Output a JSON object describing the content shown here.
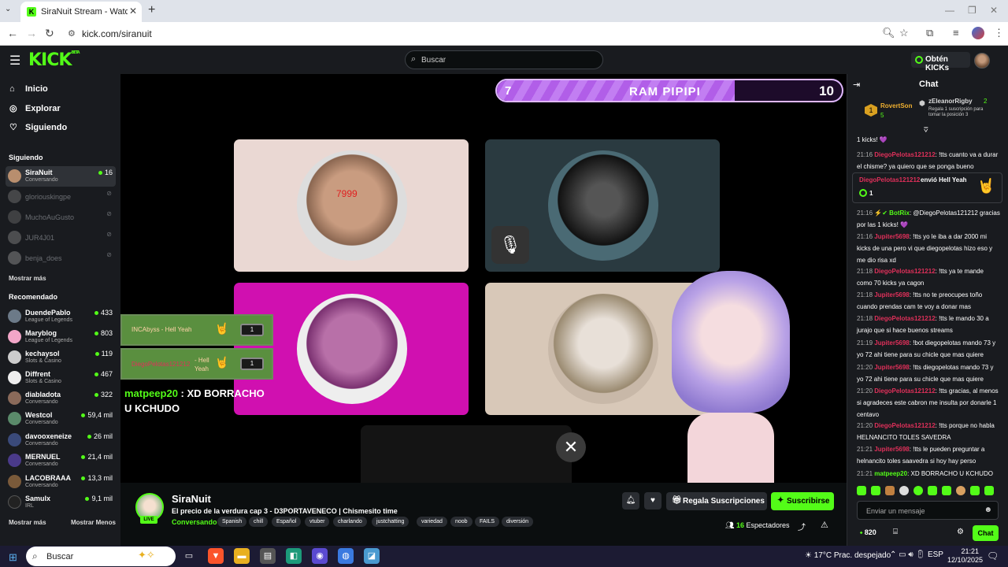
{
  "browser": {
    "tab_title": "SiraNuit Stream - Watch Live on Kick",
    "url": "kick.com/siranuit"
  },
  "nav": {
    "search_placeholder": "Buscar",
    "get_kicks": "Obtén KICKs",
    "logo": "KICK",
    "logo_beta": "BETA"
  },
  "sidebar": {
    "main": [
      {
        "label": "Inicio",
        "icon": "home-icon"
      },
      {
        "label": "Explorar",
        "icon": "compass-icon"
      },
      {
        "label": "Siguiendo",
        "icon": "heart-icon"
      }
    ],
    "following_header": "Siguiendo",
    "following": [
      {
        "name": "SiraNuit",
        "category": "Conversando",
        "viewers": "16",
        "live": true
      },
      {
        "name": "gloriouskingpe",
        "live": false
      },
      {
        "name": "MuchoAuGusto",
        "live": false
      },
      {
        "name": "JUR4J01",
        "live": false
      },
      {
        "name": "benja_does",
        "live": false
      }
    ],
    "show_more": "Mostrar más",
    "recommended_header": "Recomendado",
    "recommended": [
      {
        "name": "DuendePablo",
        "category": "League of Legends",
        "viewers": "433"
      },
      {
        "name": "Maryblog",
        "category": "League of Legends",
        "viewers": "803"
      },
      {
        "name": "kechaysol",
        "category": "Slots & Casino",
        "viewers": "119"
      },
      {
        "name": "Diffrent",
        "category": "Slots & Casino",
        "viewers": "467"
      },
      {
        "name": "diabladota",
        "category": "Conversando",
        "viewers": "322"
      },
      {
        "name": "Westcol",
        "category": "Conversando",
        "viewers": "59,4 mil"
      },
      {
        "name": "davooxeneize",
        "category": "Conversando",
        "viewers": "26 mil"
      },
      {
        "name": "MERNUEL",
        "category": "Conversando",
        "viewers": "21,4 mil"
      },
      {
        "name": "LACOBRAAA",
        "category": "Conversando",
        "viewers": "13,3 mil"
      },
      {
        "name": "Samulx",
        "category": "IRL",
        "viewers": "9,1 mil"
      }
    ],
    "show_more_2": "Mostrar más",
    "show_less": "Mostrar Menos"
  },
  "video": {
    "goal_left": "7",
    "goal_title": "RAM PIPIPI",
    "goal_right": "10",
    "goal_progress": 0.69,
    "alerts": [
      {
        "name": "INCAbyss",
        "text": "- Hell Yeah",
        "amount": "1"
      },
      {
        "name": "DiegoPelotas121212",
        "text": "- Hell Yeah",
        "amount": "1"
      }
    ],
    "overlay_chat_user": "matpeep20",
    "overlay_chat_text": ": XD BORRACHO U KCHUDO",
    "cam_text": "7999"
  },
  "stream": {
    "name": "SiraNuit",
    "live_label": "LIVE",
    "title": "El precio de la verdura cap 3 - D3PORTAVENECO | Chismesito time",
    "category": "Conversando",
    "tags": [
      "Spanish",
      "chill",
      "Español",
      "vtuber",
      "charlando",
      "justchatting",
      "variedad",
      "noob",
      "FAILS",
      "diversión"
    ],
    "gift_label": "Regala Suscripciones",
    "subscribe_label": "Suscribirse",
    "viewers_count": "16",
    "viewers_label": "Espectadores"
  },
  "chat": {
    "title": "Chat",
    "pinned": {
      "rank1_name": "RovertSon",
      "rank1_value": "5",
      "rank2_name": "zEleanorRigby",
      "rank2_value": "2",
      "rank_hint": "Regala 1 suscripción para tomar la posición 3"
    },
    "messages": [
      {
        "time": "",
        "user": "",
        "text": "1 kicks! 💜",
        "color": "pk"
      },
      {
        "time": "21:16",
        "user": "DiegoPelotas121212",
        "text": ": !tts cuanto va a durar el chisme? ya quiero que se ponga bueno",
        "color": "pk"
      },
      {
        "time": "21:16",
        "user": "BotRix",
        "text": ": @DiegoPelotas121212 gracias por las 1 kicks! 💜",
        "color": "gr"
      },
      {
        "time": "21:16",
        "user": "Jupiter5698",
        "text": ": !tts yo le iba a dar 2000 mi kicks de una pero vi que diegopelotas hizo eso y me dio risa xd",
        "color": "pk"
      },
      {
        "time": "21:18",
        "user": "DiegoPelotas121212",
        "text": ": !tts ya te mande como 70 kicks ya cagon",
        "color": "pk"
      },
      {
        "time": "21:18",
        "user": "Jupiter5698",
        "text": ": !tts no te preocupes toño cuando prendas cam te voy a donar mas",
        "color": "pk"
      },
      {
        "time": "21:18",
        "user": "DiegoPelotas121212",
        "text": ": !tts le mando 30 a jurajo que si hace buenos streams",
        "color": "pk"
      },
      {
        "time": "21:19",
        "user": "Jupiter5698",
        "text": ": !bot diegopelotas mando 73 y yo 72 ahi tiene para su chicle que mas quiere",
        "color": "pk"
      },
      {
        "time": "21:20",
        "user": "Jupiter5698",
        "text": ": !tts diegopelotas mando 73 y yo 72 ahi tiene para su chicle que mas quiere",
        "color": "pk"
      },
      {
        "time": "21:20",
        "user": "DiegoPelotas121212",
        "text": ": !tts gracias, al menos si agradeces este cabron me insulta por donarle 1 centavo",
        "color": "pk"
      },
      {
        "time": "21:20",
        "user": "DiegoPelotas121212",
        "text": ": !tts porque no habla HELNANCITO TOLES SAVEDRA",
        "color": "pk"
      },
      {
        "time": "21:21",
        "user": "Jupiter5698",
        "text": ": !tts le pueden preguntar a helnancito toles saavedra si hoy hay perso",
        "color": "pk"
      },
      {
        "time": "21:21",
        "user": "matpeep20",
        "text": ": XD BORRACHO U KCHUDO",
        "color": "gr"
      }
    ],
    "gift": {
      "user": "DiegoPelotas121212",
      "text": "envió Hell Yeah",
      "amount": "1"
    },
    "input_placeholder": "Enviar un mensaje",
    "points": "820",
    "send_label": "Chat"
  },
  "taskbar": {
    "search": "Buscar",
    "weather": "17°C  Prac. despejado",
    "lang": "ESP",
    "time": "21:21",
    "date": "12/10/2025"
  }
}
